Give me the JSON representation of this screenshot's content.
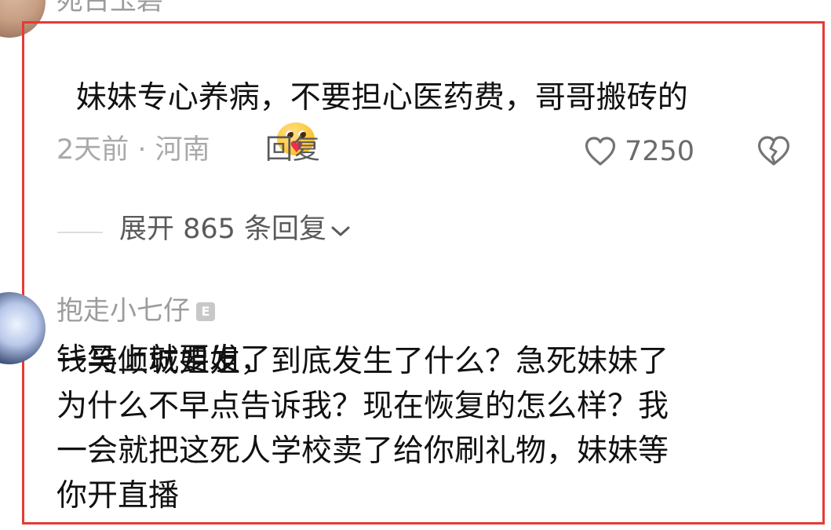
{
  "comments": {
    "top": {
      "username": "宛古玉碧",
      "text": "妹妹专心养病，不要担心医药费，哥哥搬砖的\n钱马上就要发了",
      "emoji": "hug-heart-face",
      "time_location": "2天前 · 河南",
      "reply_label": "回复",
      "like_count": "7250",
      "expand_replies_label": "展开 865 条回复"
    },
    "second": {
      "username": "抱走小七仔",
      "badge": "E",
      "text": "一笑倾城姐姐，到底发生了什么？急死妹妹了\n为什么不早点告诉我？现在恢复的怎么样？我\n一会就把这死人学校卖了给你刷礼物，妹妹等\n你开直播"
    }
  },
  "colors": {
    "highlight": "#e43b35",
    "meta": "#a9a9a9",
    "text": "#111111"
  }
}
